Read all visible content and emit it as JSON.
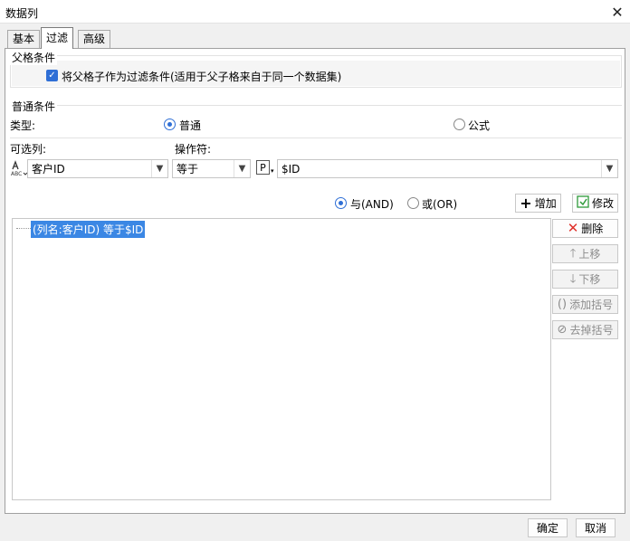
{
  "window": {
    "title": "数据列",
    "close_glyph": "✕"
  },
  "tabs": [
    {
      "label": "基本",
      "active": false
    },
    {
      "label": "过滤",
      "active": true
    },
    {
      "label": "高级",
      "active": false
    }
  ],
  "parent_section": {
    "label": "父格条件",
    "checkbox_label": "将父格子作为过滤条件(适用于父子格来自于同一个数据集)",
    "checked": true
  },
  "normal_section": {
    "label": "普通条件",
    "type_label": "类型:",
    "type_options": [
      {
        "label": "普通",
        "selected": true
      },
      {
        "label": "公式",
        "selected": false
      }
    ],
    "column_label": "可选列:",
    "operator_label": "操作符:",
    "column_value": "客户ID",
    "operator_value": "等于",
    "param_value": "$ID",
    "param_icon": "P"
  },
  "logic": {
    "and_label": "与(AND)",
    "or_label": "或(OR)",
    "and_selected": true,
    "add_label": "增加",
    "modify_label": "修改"
  },
  "conditions": [
    {
      "text": "(列名:客户ID) 等于$ID",
      "selected": true
    }
  ],
  "side_buttons": {
    "delete": "删除",
    "move_up": "上移",
    "move_down": "下移",
    "add_bracket": "添加括号",
    "remove_bracket": "去掉括号"
  },
  "footer": {
    "ok": "确定",
    "cancel": "取消"
  },
  "colors": {
    "accent": "#2f6fd6",
    "selection": "#3b87e4",
    "delete_red": "#e0302a",
    "add_green": "#2e9b3a"
  }
}
